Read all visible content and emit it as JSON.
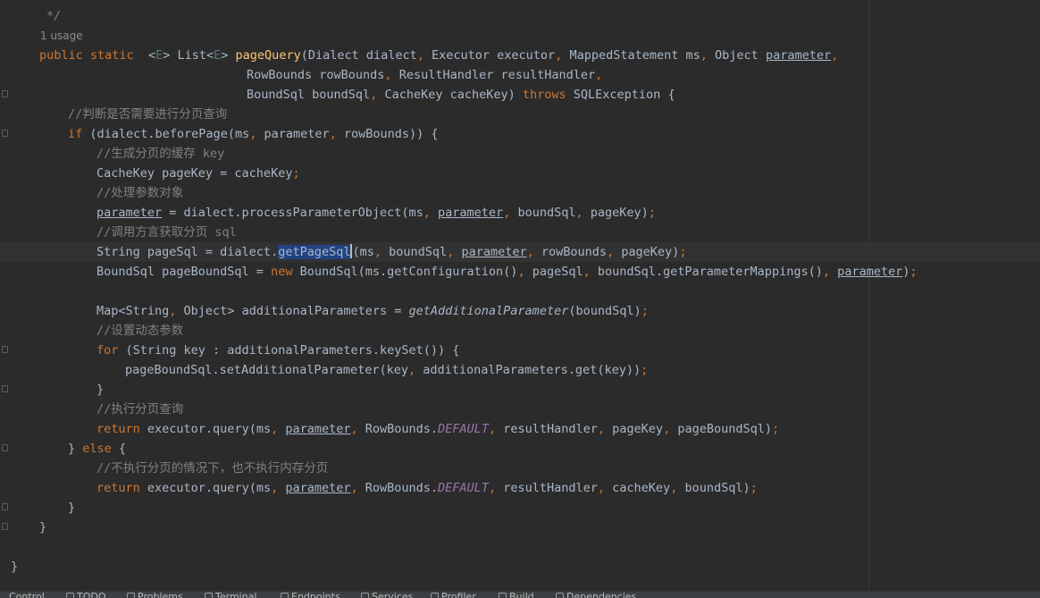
{
  "editor": {
    "usage_hint": "1 usage",
    "comment_tail": "*/",
    "lines": {
      "l1": [
        "public",
        " ",
        "static",
        "  <",
        "E",
        "> List<",
        "E",
        "> ",
        "pageQuery",
        "(Dialect dialect",
        ", ",
        "Executor executor",
        ", ",
        "MappedStatement ms",
        ", ",
        "Object ",
        "parameter",
        ","
      ],
      "l2": [
        "RowBounds rowBounds",
        ", ",
        "ResultHandler resultHandler",
        ","
      ],
      "l3": [
        "BoundSql boundSql",
        ", ",
        "CacheKey cacheKey) ",
        "throws ",
        "SQLException {"
      ],
      "l4": [
        "//判断是否需要进行分页查询"
      ],
      "l5": [
        "if ",
        "(dialect.beforePage(ms",
        ", ",
        "parameter",
        ", ",
        "rowBounds)) {"
      ],
      "l6": [
        "//生成分页的缓存 key"
      ],
      "l7": [
        "CacheKey pageKey = cacheKey",
        ";"
      ],
      "l8": [
        "//处理参数对象"
      ],
      "l9": [
        "parameter",
        " = dialect.processParameterObject(ms",
        ", ",
        "parameter",
        ", ",
        "boundSql",
        ", ",
        "pageKey)",
        ";"
      ],
      "l10": [
        "//调用方言获取分页 sql"
      ],
      "l11": [
        "String pageSql = dialect.",
        "getPageSql",
        "(ms",
        ", ",
        "boundSql",
        ", ",
        "parameter",
        ", ",
        "rowBounds",
        ", ",
        "pageKey)",
        ";"
      ],
      "l12": [
        "BoundSql pageBoundSql = ",
        "new ",
        "BoundSql(ms.getConfiguration()",
        ", ",
        "pageSql",
        ", ",
        "boundSql.getParameterMappings()",
        ", ",
        "parameter",
        ")",
        ";"
      ],
      "l13": [
        "Map<String",
        ", ",
        "Object> additionalParameters = ",
        "getAdditionalParameter",
        "(boundSql)",
        ";"
      ],
      "l14": [
        "//设置动态参数"
      ],
      "l15": [
        "for ",
        "(String key : additionalParameters.keySet()) {"
      ],
      "l16": [
        "pageBoundSql.setAdditionalParameter(key",
        ", ",
        "additionalParameters.get(key))",
        ";"
      ],
      "l17": [
        "}"
      ],
      "l18": [
        "//执行分页查询"
      ],
      "l19": [
        "return ",
        "executor.query(ms",
        ", ",
        "parameter",
        ", ",
        "RowBounds.",
        "DEFAULT",
        ", ",
        "resultHandler",
        ", ",
        "pageKey",
        ", ",
        "pageBoundSql)",
        ";"
      ],
      "l20": [
        "} ",
        "else ",
        "{"
      ],
      "l21": [
        "//不执行分页的情况下，也不执行内存分页"
      ],
      "l22": [
        "return ",
        "executor.query(ms",
        ", ",
        "parameter",
        ", ",
        "RowBounds.",
        "DEFAULT",
        ", ",
        "resultHandler",
        ", ",
        "cacheKey",
        ", ",
        "boundSql)",
        ";"
      ],
      "l23": [
        "}"
      ],
      "l24": [
        "}"
      ],
      "l25": [
        "}"
      ]
    }
  },
  "colors": {
    "background": "#2b2b2b",
    "keyword": "#cc7832",
    "method_declaration": "#ffc66d",
    "comment": "#808080",
    "static_field": "#9876aa",
    "type_parameter": "#507874",
    "default_text": "#a9b7c6",
    "selection": "#214283"
  },
  "tool_windows": [
    {
      "label": "Control",
      "icon": "version-control-icon"
    },
    {
      "label": "TODO",
      "icon": "todo-icon"
    },
    {
      "label": "Problems",
      "icon": "problems-icon"
    },
    {
      "label": "Terminal",
      "icon": "terminal-icon"
    },
    {
      "label": "Endpoints",
      "icon": "endpoints-icon"
    },
    {
      "label": "Services",
      "icon": "services-icon"
    },
    {
      "label": "Profiler",
      "icon": "profiler-icon"
    },
    {
      "label": "Build",
      "icon": "build-icon"
    },
    {
      "label": "Dependencies",
      "icon": "dependencies-icon"
    }
  ]
}
